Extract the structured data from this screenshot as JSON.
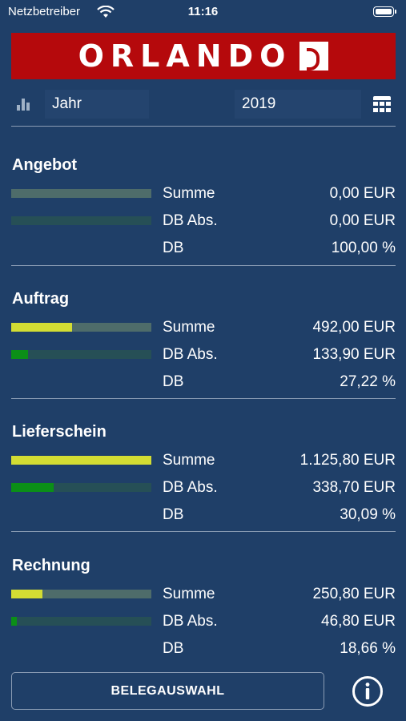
{
  "status_bar": {
    "carrier": "Netzbetreiber",
    "time": "11:16"
  },
  "header": {
    "logo_text": "ORLANDO"
  },
  "filter": {
    "period": "Jahr",
    "year": "2019"
  },
  "colors": {
    "background": "#1f3f68",
    "banner": "#b5090c",
    "summe_track": "#4e6c6a",
    "summe_fill": "#d3dd33",
    "db_track": "#264f56",
    "db_fill": "#0b8f17"
  },
  "sections": [
    {
      "title": "Angebot",
      "rows": [
        {
          "label": "Summe",
          "value": "0,00 EUR"
        },
        {
          "label": "DB Abs.",
          "value": "0,00 EUR"
        },
        {
          "label": "DB",
          "value": "100,00 %"
        }
      ],
      "summe_fraction": 0,
      "db_fraction": 0
    },
    {
      "title": "Auftrag",
      "rows": [
        {
          "label": "Summe",
          "value": "492,00 EUR"
        },
        {
          "label": "DB Abs.",
          "value": "133,90 EUR"
        },
        {
          "label": "DB",
          "value": "27,22 %"
        }
      ],
      "summe_fraction": 0.437,
      "db_fraction": 0.119
    },
    {
      "title": "Lieferschein",
      "rows": [
        {
          "label": "Summe",
          "value": "1.125,80 EUR"
        },
        {
          "label": "DB Abs.",
          "value": "338,70 EUR"
        },
        {
          "label": "DB",
          "value": "30,09 %"
        }
      ],
      "summe_fraction": 1.0,
      "db_fraction": 0.301
    },
    {
      "title": "Rechnung",
      "rows": [
        {
          "label": "Summe",
          "value": "250,80 EUR"
        },
        {
          "label": "DB Abs.",
          "value": "46,80 EUR"
        },
        {
          "label": "DB",
          "value": "18,66 %"
        }
      ],
      "summe_fraction": 0.223,
      "db_fraction": 0.042
    }
  ],
  "footer": {
    "button_label": "BELEGAUSWAHL"
  }
}
